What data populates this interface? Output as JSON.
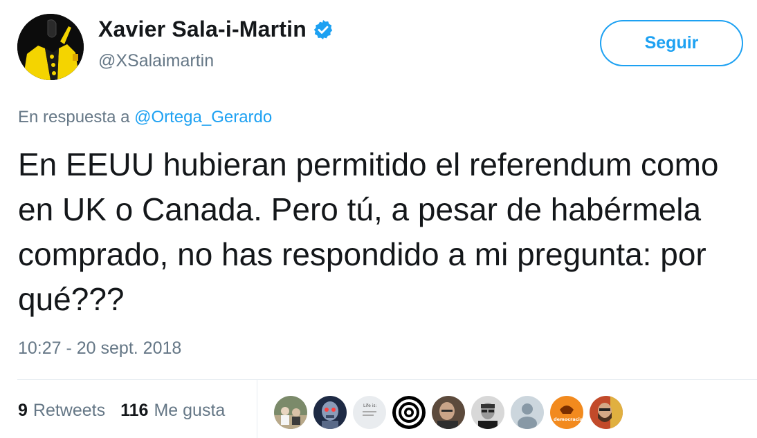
{
  "author": {
    "name": "Xavier Sala-i-Martin",
    "handle": "@XSalaimartin",
    "verified": true
  },
  "follow_button": {
    "label": "Seguir"
  },
  "reply_context": {
    "prefix": "En respuesta a",
    "mention": "@Ortega_Gerardo"
  },
  "tweet": {
    "text": "En EEUU hubieran permitido el referendum como en UK o Canada. Pero tú, a pesar de habérmela comprado, no has respondido a mi pregunta: por qué???",
    "timestamp": "10:27 - 20 sept. 2018"
  },
  "stats": {
    "retweets_count": "9",
    "retweets_label": "Retweets",
    "likes_count": "116",
    "likes_label": "Me gusta"
  },
  "colors": {
    "accent": "#1da1f2",
    "secondary_text": "#657786",
    "primary_text": "#14171a",
    "avatar_yellow": "#f4d400"
  },
  "likers": [
    {
      "icon": "outdoor-group-photo"
    },
    {
      "icon": "robot-photo"
    },
    {
      "icon": "text-card-photo",
      "text": "Life is:"
    },
    {
      "icon": "concentric-circles"
    },
    {
      "icon": "bald-man-photo"
    },
    {
      "icon": "man-with-glasses-photo"
    },
    {
      "icon": "default-avatar"
    },
    {
      "icon": "orange-logo",
      "text": "democracia!"
    },
    {
      "icon": "bearded-man-photo"
    }
  ]
}
